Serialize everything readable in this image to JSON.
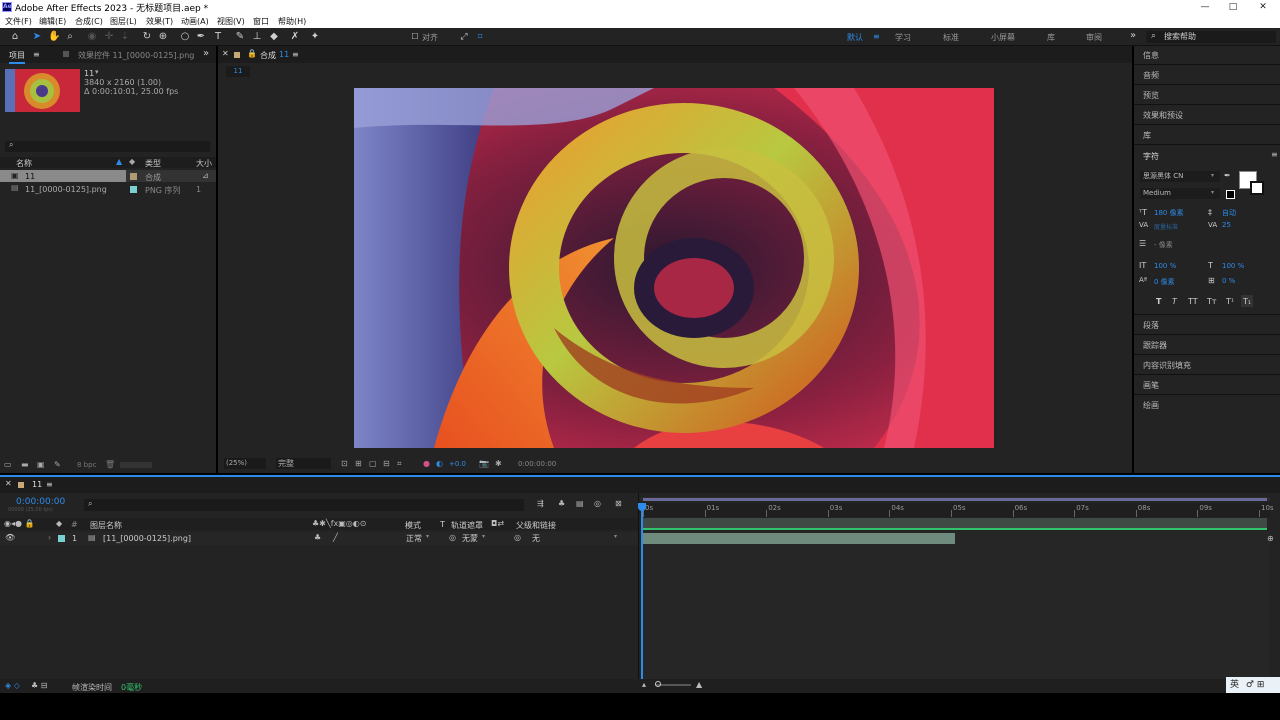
{
  "app": {
    "title": "Adobe After Effects 2023 - 无标题项目.aep *",
    "logo_text": "Ae"
  },
  "window_controls": {
    "minimize": "—",
    "maximize": "□",
    "close": "✕"
  },
  "menu": [
    "文件(F)",
    "编辑(E)",
    "合成(C)",
    "图层(L)",
    "效果(T)",
    "动画(A)",
    "视图(V)",
    "窗口",
    "帮助(H)"
  ],
  "toolbar": {
    "align_label": "对齐",
    "workspaces": [
      "默认",
      "学习",
      "标准",
      "小屏幕",
      "库",
      "审阅"
    ],
    "active_workspace": "默认",
    "more": "»",
    "search_placeholder": "搜索帮助"
  },
  "project": {
    "tab_label": "项目",
    "effects_tab": "效果控件 11_[0000-0125].png",
    "comp_name": "11",
    "comp_size": "3840 x 2160 (1.00)",
    "comp_duration": "Δ 0:00:10:01, 25.00 fps",
    "search_placeholder": "",
    "col_name": "名称",
    "col_type": "类型",
    "col_size": "大小",
    "items": [
      {
        "name": "11",
        "type": "合成",
        "selected": true,
        "color": "#b29a72"
      },
      {
        "name": "11_[0000-0125].png",
        "type": "PNG 序列",
        "size": "1",
        "selected": false,
        "color": "#7ad0d0"
      }
    ],
    "bpc": "8 bpc"
  },
  "composition": {
    "tab_prefix": "合成",
    "tab_name": "11",
    "breadcrumb": "11",
    "zoom": "(25%)",
    "resolution": "完整",
    "exposure": "+0.0",
    "timecode": "0:00:00:00"
  },
  "right": {
    "sections": [
      "信息",
      "音频",
      "预览",
      "效果和预设",
      "库"
    ],
    "character": {
      "title": "字符",
      "font": "思源黑体 CN",
      "style": "Medium",
      "size": "180 像素",
      "leading": "自动",
      "kerning": "度量标准",
      "tracking": "25",
      "stroke": "- 像素",
      "vscale": "100 %",
      "hscale": "100 %",
      "baseline": "0 像素",
      "tsume": "0 %",
      "styles": [
        "T",
        "T",
        "TT",
        "Tт",
        "T¹",
        "T₁"
      ]
    },
    "more_sections": [
      "段落",
      "跟踪器",
      "内容识别填充",
      "画笔",
      "绘画"
    ]
  },
  "timeline": {
    "comp_tab": "11",
    "timecode": "0:00:00:00",
    "timecode_sub": "00000 (25.00 fps)",
    "cols": {
      "layer_name": "图层名称",
      "mode": "模式",
      "t": "T",
      "trkmat": "轨道遮罩",
      "parent": "父级和链接"
    },
    "layer": {
      "index": "1",
      "name": "[11_[0000-0125].png]",
      "mode": "正常",
      "matte": "无蒙",
      "parent": "无"
    },
    "ruler": [
      "0s",
      "01s",
      "02s",
      "03s",
      "04s",
      "05s",
      "06s",
      "07s",
      "08s",
      "09s",
      "10s"
    ],
    "clip_end_fraction": 0.5
  },
  "status": {
    "render_label": "帧渲染时间",
    "render_value": "0毫秒",
    "ime": "英"
  },
  "colors": {
    "accent": "#2d8ceb",
    "panel": "#232323",
    "work_area": "#5b7a6a",
    "clip": "#6f8b7d"
  }
}
